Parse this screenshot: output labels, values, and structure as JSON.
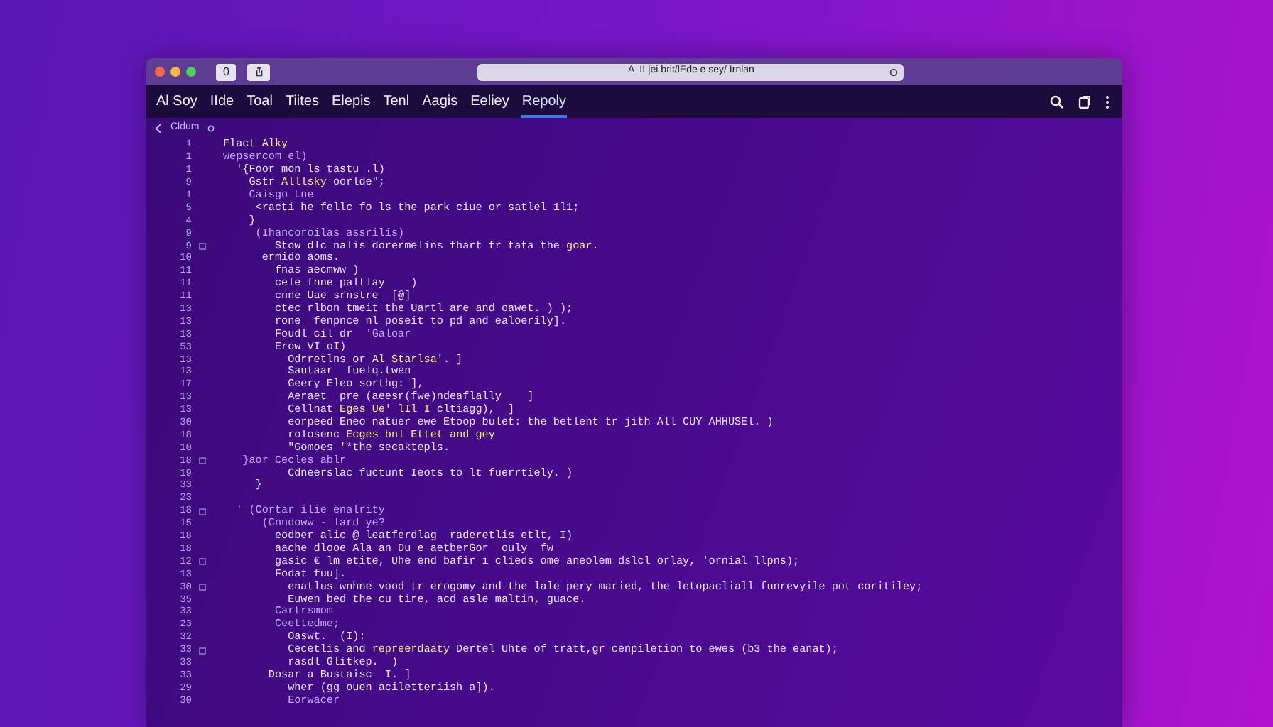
{
  "window": {
    "title": "A  II |ei brit/lEde e sey/ Irnlan",
    "toolbar_buttons": [
      "0"
    ]
  },
  "tabs": [
    {
      "label": "Al Soy",
      "selected": false
    },
    {
      "label": "IIde",
      "selected": false
    },
    {
      "label": "Toal",
      "selected": false
    },
    {
      "label": "Tiites",
      "selected": false
    },
    {
      "label": "Elepis",
      "selected": false
    },
    {
      "label": "Tenl",
      "selected": false
    },
    {
      "label": "Aagis",
      "selected": false
    },
    {
      "label": "Eeliey",
      "selected": false
    },
    {
      "label": "Repoly",
      "selected": true
    }
  ],
  "breadcrumb": {
    "label": "Cldum"
  },
  "code_lines": [
    {
      "number": "1",
      "segments": [
        {
          "text": "Flact ",
          "kind": "plain"
        },
        {
          "text": "Alky",
          "kind": "accent"
        }
      ],
      "fold": false
    },
    {
      "number": "1",
      "segments": [
        {
          "text": "wepsercom el)",
          "kind": "keyword"
        }
      ],
      "fold": false
    },
    {
      "number": "1",
      "segments": [
        {
          "text": "  '{Foor mon ls tastu .l)",
          "kind": "plain"
        }
      ],
      "fold": false
    },
    {
      "number": "9",
      "segments": [
        {
          "text": "    Gstr ",
          "kind": "plain"
        },
        {
          "text": "Alllsky",
          "kind": "accent"
        },
        {
          "text": " oorlde\";",
          "kind": "plain"
        }
      ],
      "fold": false
    },
    {
      "number": "1",
      "segments": [
        {
          "text": "    Caisgo Lne",
          "kind": "keyword"
        }
      ],
      "fold": false
    },
    {
      "number": "5",
      "segments": [
        {
          "text": "     <racti he fellc fo ls the park ciue or satlel 1l1;",
          "kind": "plain"
        }
      ],
      "fold": false
    },
    {
      "number": "4",
      "segments": [
        {
          "text": "    }",
          "kind": "plain"
        }
      ],
      "fold": false
    },
    {
      "number": "9",
      "segments": [
        {
          "text": "     (Ihancoroilas assrilis)",
          "kind": "keyword"
        }
      ],
      "fold": false
    },
    {
      "number": "9",
      "segments": [
        {
          "text": "        Stow dlc nalis dorermelins fhart fr tata the ",
          "kind": "plain"
        },
        {
          "text": "goar.",
          "kind": "accent"
        }
      ],
      "fold": true
    },
    {
      "number": "10",
      "segments": [
        {
          "text": "      ermido aoms.",
          "kind": "plain"
        }
      ],
      "fold": false
    },
    {
      "number": "11",
      "segments": [
        {
          "text": "        fnas aecmww )",
          "kind": "plain"
        }
      ],
      "fold": false
    },
    {
      "number": "11",
      "segments": [
        {
          "text": "        cele fnne paltlay    )",
          "kind": "plain"
        }
      ],
      "fold": false
    },
    {
      "number": "11",
      "segments": [
        {
          "text": "        cnne Uae srnstre  [@]",
          "kind": "plain"
        }
      ],
      "fold": false
    },
    {
      "number": "13",
      "segments": [
        {
          "text": "        ctec rlbon tmeit the Uartl are and oawet. ) );",
          "kind": "plain"
        }
      ],
      "fold": false
    },
    {
      "number": "13",
      "segments": [
        {
          "text": "        rone  fenpnce nl poseit to pd and ealoerily].",
          "kind": "plain"
        }
      ],
      "fold": false
    },
    {
      "number": "13",
      "segments": [
        {
          "text": "        Foudl cil dr  ",
          "kind": "plain"
        },
        {
          "text": "'Galoar",
          "kind": "keyword"
        }
      ],
      "fold": false
    },
    {
      "number": "53",
      "segments": [
        {
          "text": "        Erow VI oI)",
          "kind": "plain"
        }
      ],
      "fold": false
    },
    {
      "number": "13",
      "segments": [
        {
          "text": "          Odrretlns or ",
          "kind": "plain"
        },
        {
          "text": "Al Starlsa",
          "kind": "accent"
        },
        {
          "text": "'. ]",
          "kind": "plain"
        }
      ],
      "fold": false
    },
    {
      "number": "13",
      "segments": [
        {
          "text": "          Sautaar  fuelq.twen",
          "kind": "plain"
        }
      ],
      "fold": false
    },
    {
      "number": "17",
      "segments": [
        {
          "text": "          Geery Eleo sorthg: ],",
          "kind": "plain"
        }
      ],
      "fold": false
    },
    {
      "number": "13",
      "segments": [
        {
          "text": "          Aeraet  pre (aeesr(fwe)ndeaflally    ]",
          "kind": "plain"
        }
      ],
      "fold": false
    },
    {
      "number": "13",
      "segments": [
        {
          "text": "          Cellnat ",
          "kind": "plain"
        },
        {
          "text": "Eges Ue' lIl I",
          "kind": "accent"
        },
        {
          "text": " cltiagg),  ]",
          "kind": "plain"
        }
      ],
      "fold": false
    },
    {
      "number": "30",
      "segments": [
        {
          "text": "          eorpeed Eneo natuer ewe Etoop bulet: the betlent tr jith All CUY AHHUSEl. )",
          "kind": "plain"
        }
      ],
      "fold": false
    },
    {
      "number": "18",
      "segments": [
        {
          "text": "          rolosenc ",
          "kind": "plain"
        },
        {
          "text": "Ecges bnl Ettet and gey",
          "kind": "accent"
        }
      ],
      "fold": false
    },
    {
      "number": "10",
      "segments": [
        {
          "text": "          \"Gomoes '*the secaktepls.",
          "kind": "plain"
        }
      ],
      "fold": false
    },
    {
      "number": "18",
      "segments": [
        {
          "text": "   }aor Cecles ablr",
          "kind": "keyword"
        }
      ],
      "fold": true
    },
    {
      "number": "19",
      "segments": [
        {
          "text": "          Cdneerslac fuctunt Ieots to lt fuerrtiely. )",
          "kind": "plain"
        }
      ],
      "fold": false
    },
    {
      "number": "33",
      "segments": [
        {
          "text": "     }",
          "kind": "plain"
        }
      ],
      "fold": false
    },
    {
      "number": "23",
      "fold": false
    },
    {
      "number": "18",
      "segments": [
        {
          "text": "  ' (Cortar ilie enalrity",
          "kind": "keyword"
        }
      ],
      "fold": true
    },
    {
      "number": "15",
      "segments": [
        {
          "text": "      (Cnndoww - lard ye?",
          "kind": "keyword"
        }
      ],
      "fold": false
    },
    {
      "number": "18",
      "segments": [
        {
          "text": "        eodber alic @ leatferdlag  raderetlis etlt, I)",
          "kind": "plain"
        }
      ],
      "fold": false
    },
    {
      "number": "18",
      "segments": [
        {
          "text": "        aache dlooe Ala an Du e aetberGor  ouly  fw",
          "kind": "plain"
        }
      ],
      "fold": false
    },
    {
      "number": "12",
      "segments": [
        {
          "text": "        gasic € lm etite, Uhe end bafir ı clieds ome aneolem dslcl orlay, 'ornial llpns);",
          "kind": "plain"
        }
      ],
      "fold": true
    },
    {
      "number": "13",
      "segments": [
        {
          "text": "        Fodat fuu].",
          "kind": "plain"
        }
      ],
      "fold": false
    },
    {
      "number": "30",
      "segments": [
        {
          "text": "          enatlus wnhne vood tr erogomy and the lale pery maried, the letopacliall funrevyile pot coritiley;",
          "kind": "plain"
        }
      ],
      "fold": true
    },
    {
      "number": "35",
      "segments": [
        {
          "text": "          Euwen bed the cu tire, acd asle maltin, guace.",
          "kind": "plain"
        }
      ],
      "fold": false
    },
    {
      "number": "33",
      "segments": [
        {
          "text": "        Cartrsmom",
          "kind": "keyword"
        }
      ],
      "fold": false
    },
    {
      "number": "23",
      "segments": [
        {
          "text": "        Ceettedme;",
          "kind": "keyword"
        }
      ],
      "fold": false
    },
    {
      "number": "32",
      "segments": [
        {
          "text": "          Oaswt.  (I):",
          "kind": "plain"
        }
      ],
      "fold": false
    },
    {
      "number": "33",
      "segments": [
        {
          "text": "          Cecetlis and ",
          "kind": "plain"
        },
        {
          "text": "repreerdaaty",
          "kind": "accent"
        },
        {
          "text": " Dertel Uhte of tratt,gr cenpiletion to ewes (b3 the eanat);",
          "kind": "plain"
        }
      ],
      "fold": true
    },
    {
      "number": "33",
      "segments": [
        {
          "text": "          rasdl Glitkep.  )",
          "kind": "plain"
        }
      ],
      "fold": false
    },
    {
      "number": "33",
      "segments": [
        {
          "text": "       Dosar a Bustaisc  I. ]",
          "kind": "plain"
        }
      ],
      "fold": false
    },
    {
      "number": "29",
      "segments": [
        {
          "text": "          wher (gg ouen aciletteriish a]).",
          "kind": "plain"
        }
      ],
      "fold": false
    },
    {
      "number": "30",
      "segments": [
        {
          "text": "          Eorwacer",
          "kind": "keyword"
        }
      ],
      "fold": false
    }
  ]
}
